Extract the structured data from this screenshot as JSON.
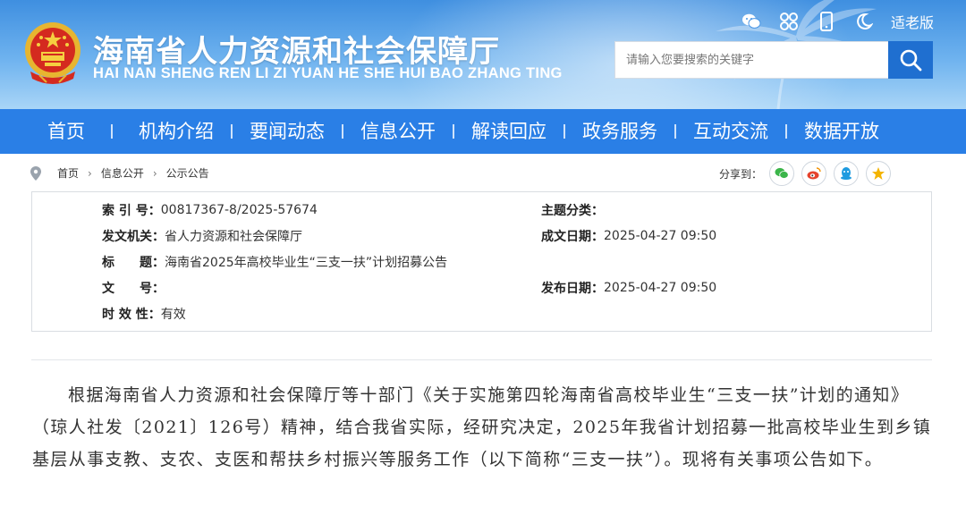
{
  "header": {
    "title": "海南省人力资源和社会保障厅",
    "subtitle": "HAI NAN SHENG REN LI ZI YUAN HE SHE HUI BAO ZHANG TING",
    "elder_mode": "适老版",
    "search_placeholder": "请输入您要搜索的关键字"
  },
  "nav": {
    "items": [
      "首页",
      "机构介绍",
      "要闻动态",
      "信息公开",
      "解读回应",
      "政务服务",
      "互动交流",
      "数据开放"
    ]
  },
  "breadcrumb": [
    "首页",
    "信息公开",
    "公示公告"
  ],
  "share": {
    "label": "分享到："
  },
  "meta": {
    "index_label": "索 引 号：",
    "index_value": "00817367-8/2025-57674",
    "topic_label": "主题分类：",
    "topic_value": "",
    "issuer_label": "发文机关：",
    "issuer_value": "省人力资源和社会保障厅",
    "created_label": "成文日期：",
    "created_value": "2025-04-27 09:50",
    "title_label": "标　　题：",
    "title_value": "海南省2025年高校毕业生“三支一扶”计划招募公告",
    "docno_label": "文　　号：",
    "docno_value": "",
    "published_label": "发布日期：",
    "published_value": "2025-04-27 09:50",
    "validity_label": "时 效 性：",
    "validity_value": "有效"
  },
  "content": {
    "paragraph": "根据海南省人力资源和社会保障厅等十部门《关于实施第四轮海南省高校毕业生“三支一扶”计划的通知》（琼人社发〔2021〕126号）精神，结合我省实际，经研究决定，2025年我省计划招募一批高校毕业生到乡镇基层从事支教、支农、支医和帮扶乡村振兴等服务工作（以下简称“三支一扶”）。现将有关事项公告如下。"
  },
  "colors": {
    "nav_bg": "#2a7fe6",
    "header_top": "#3f8fe0",
    "search_btn": "#1f6fd0"
  }
}
